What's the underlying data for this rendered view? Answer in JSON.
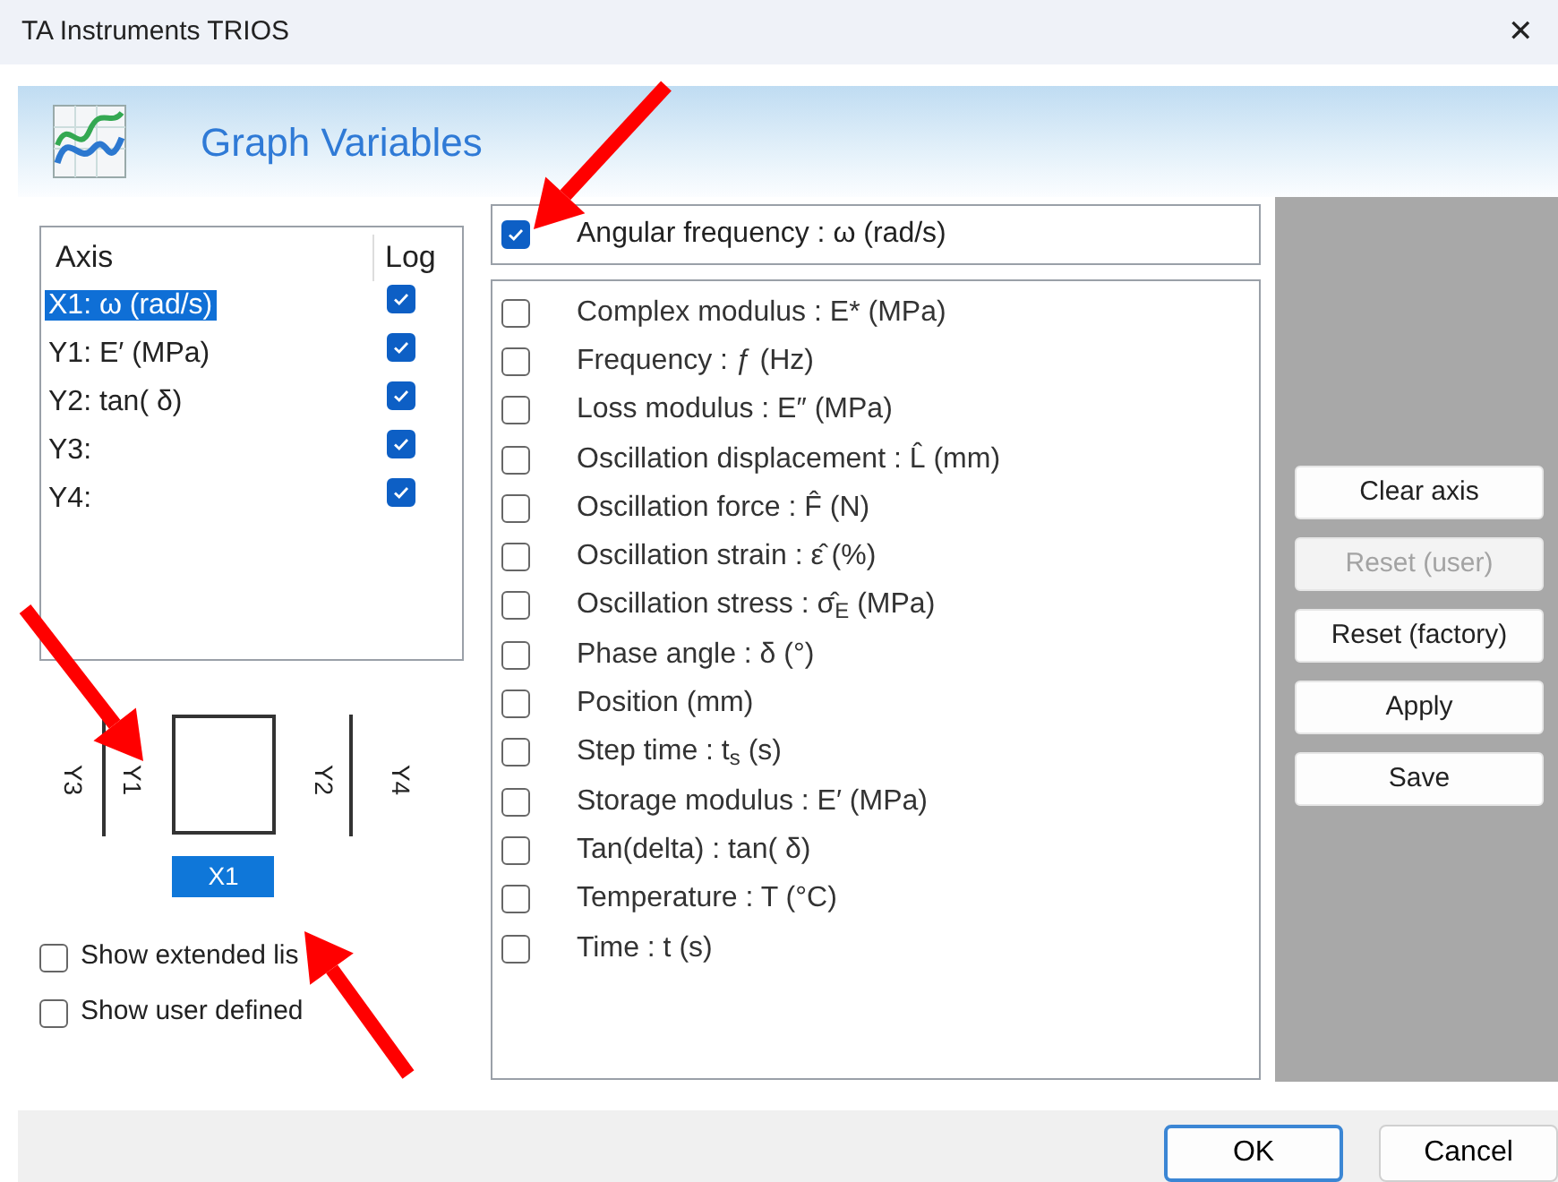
{
  "window": {
    "title": "TA Instruments TRIOS",
    "close": "✕"
  },
  "header": {
    "title": "Graph Variables"
  },
  "axis_list": {
    "columns": [
      "Axis",
      "Log"
    ],
    "rows": [
      {
        "label": "X1:  ω (rad/s)",
        "log": true,
        "selected": true
      },
      {
        "label": "Y1:  E′ (MPa)",
        "log": true,
        "selected": false
      },
      {
        "label": "Y2: tan( δ)",
        "log": true,
        "selected": false
      },
      {
        "label": "Y3:",
        "log": true,
        "selected": false
      },
      {
        "label": "Y4:",
        "log": true,
        "selected": false
      }
    ]
  },
  "axis_diagram": {
    "left_outer": "Y3",
    "left_inner": "Y1",
    "right_inner": "Y2",
    "right_outer": "Y4",
    "bottom": "X1",
    "bottom_selected": true
  },
  "options": [
    {
      "label": "Show extended lis",
      "checked": false
    },
    {
      "label": "Show user defined",
      "checked": false
    }
  ],
  "current_variable": {
    "label": "Angular frequency :  ω  (rad/s)",
    "checked": true
  },
  "variables": [
    {
      "label": "Complex modulus :  E*  (MPa)",
      "checked": false
    },
    {
      "label": "Frequency :  ƒ  (Hz)",
      "checked": false
    },
    {
      "label": "Loss modulus :  E″  (MPa)",
      "checked": false
    },
    {
      "label": "Oscillation displacement :  L̂  (mm)",
      "checked": false
    },
    {
      "label": "Oscillation force :  F̂  (N)",
      "checked": false
    },
    {
      "label": "Oscillation strain :  ε̂  (%)",
      "checked": false
    },
    {
      "label": "Oscillation stress :  σ̂$_{E}$  (MPa)",
      "checked": false
    },
    {
      "label": "Phase angle :  δ  (°)",
      "checked": false
    },
    {
      "label": "Position  (mm)",
      "checked": false
    },
    {
      "label": "Step time :  t$_{s}$  (s)",
      "checked": false
    },
    {
      "label": "Storage modulus :  E′  (MPa)",
      "checked": false
    },
    {
      "label": "Tan(delta) : tan( δ)",
      "checked": false
    },
    {
      "label": "Temperature :  T  (°C)",
      "checked": false
    },
    {
      "label": "Time :  t  (s)",
      "checked": false
    }
  ],
  "side_buttons": [
    {
      "label": "Clear axis",
      "disabled": false
    },
    {
      "label": "Reset (user)",
      "disabled": true
    },
    {
      "label": "Reset (factory)",
      "disabled": false
    },
    {
      "label": "Apply",
      "disabled": false
    },
    {
      "label": "Save",
      "disabled": false
    }
  ],
  "footer_buttons": [
    {
      "label": "OK",
      "default": true
    },
    {
      "label": "Cancel",
      "default": false
    }
  ]
}
